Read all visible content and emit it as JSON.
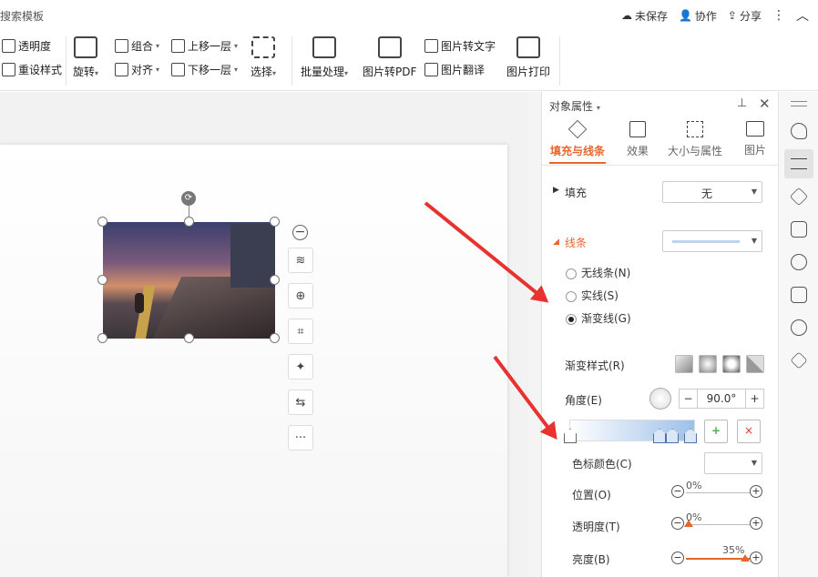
{
  "topbar": {
    "search_text": "搜索模板",
    "unsaved_label": "未保存",
    "collab_label": "协作",
    "share_label": "分享"
  },
  "ribbon": {
    "transparency": "透明度",
    "reset_style": "重设样式",
    "rotate": "旋转",
    "group": "组合",
    "align": "对齐",
    "move_up": "上移一层",
    "move_down": "下移一层",
    "select": "选择",
    "batch": "批量处理",
    "img_to_pdf": "图片转PDF",
    "img_to_text": "图片转文字",
    "img_translate": "图片翻译",
    "img_print": "图片打印"
  },
  "panel": {
    "title": "对象属性",
    "tabs": [
      "填充与线条",
      "效果",
      "大小与属性",
      "图片"
    ],
    "fill_label": "填充",
    "fill_value": "无",
    "line_label": "线条",
    "radio_none": "无线条(N)",
    "radio_solid": "实线(S)",
    "radio_gradient": "渐变线(G)",
    "grad_style_label": "渐变样式(R)",
    "angle_label": "角度(E)",
    "angle_value": "90.0°",
    "stop_color_label": "色标颜色(C)",
    "position_label": "位置(O)",
    "position_value": "0%",
    "transparency_label": "透明度(T)",
    "transparency_value": "0%",
    "brightness_label": "亮度(B)",
    "brightness_value": "35%"
  },
  "colors": {
    "accent": "#e8662c",
    "arrow": "#e8322f"
  }
}
